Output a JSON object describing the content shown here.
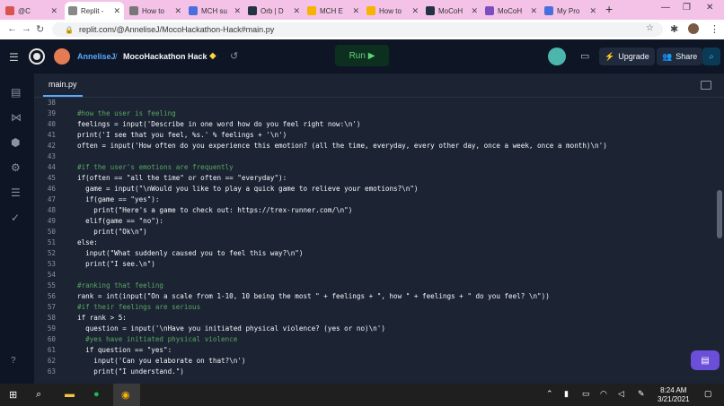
{
  "browser": {
    "tabs": [
      {
        "label": "@C",
        "favicon_color": "#d9534f"
      },
      {
        "label": "Replit -",
        "favicon_color": "#888888",
        "active": true
      },
      {
        "label": "How to",
        "favicon_color": "#777777"
      },
      {
        "label": "MCH su",
        "favicon_color": "#4a6fdc"
      },
      {
        "label": "Orb | D",
        "favicon_color": "#223344"
      },
      {
        "label": "MCH E",
        "favicon_color": "#f4b400"
      },
      {
        "label": "How to",
        "favicon_color": "#f4b400"
      },
      {
        "label": "MoCoH",
        "favicon_color": "#223344"
      },
      {
        "label": "MoCoH",
        "favicon_color": "#7b4fbf"
      },
      {
        "label": "My Pro",
        "favicon_color": "#4a6fdc"
      }
    ],
    "new_tab_icon": "plus-icon",
    "url": "replit.com/@AnneliseJ/MocoHackathon-Hack#main.py"
  },
  "replit": {
    "username": "AnneliseJ",
    "separator": "/",
    "project": "MocoHackathon Hack",
    "run_label": "Run ▶",
    "upgrade_label": "Upgrade",
    "share_label": "Share"
  },
  "editor": {
    "file_tab": "main.py",
    "lines": [
      {
        "n": "38",
        "text": ""
      },
      {
        "n": "39",
        "text": "#how the user is feeling",
        "color": "#58a862"
      },
      {
        "n": "40",
        "text": "feelings = input('Describe in one word how do you feel right now:\\n')"
      },
      {
        "n": "41",
        "text": "print('I see that you feel, %s.' % feelings + '\\n')"
      },
      {
        "n": "42",
        "text": "often = input('How often do you experience this emotion? (all the time, everyday, every other day, once a week, once a month)\\n')"
      },
      {
        "n": "43",
        "text": ""
      },
      {
        "n": "44",
        "text": "#if the user's emotions are frequently",
        "color": "#58a862"
      },
      {
        "n": "45",
        "text": "if(often == \"all the time\" or often == \"everyday\"):"
      },
      {
        "n": "46",
        "text": "  game = input(\"\\nWould you like to play a quick game to relieve your emotions?\\n\")"
      },
      {
        "n": "47",
        "text": "  if(game == \"yes\"):"
      },
      {
        "n": "48",
        "text": "    print(\"Here's a game to check out: https://trex-runner.com/\\n\")"
      },
      {
        "n": "49",
        "text": "  elif(game == \"no\"):"
      },
      {
        "n": "50",
        "text": "    print(\"Ok\\n\")"
      },
      {
        "n": "51",
        "text": "else:"
      },
      {
        "n": "52",
        "text": "  input(\"What suddenly caused you to feel this way?\\n\")"
      },
      {
        "n": "53",
        "text": "  print(\"I see.\\n\")"
      },
      {
        "n": "54",
        "text": ""
      },
      {
        "n": "55",
        "text": "#ranking that feeling",
        "color": "#58a862"
      },
      {
        "n": "56",
        "text": "rank = int(input(\"On a scale from 1-10, 10 being the most \" + feelings + \", how \" + feelings + \" do you feel? \\n\"))"
      },
      {
        "n": "57",
        "text": "#if their feelings are serious",
        "color": "#58a862"
      },
      {
        "n": "58",
        "text": "if rank > 5:"
      },
      {
        "n": "59",
        "text": "  question = input('\\nHave you initiated physical violence? (yes or no)\\n')"
      },
      {
        "n": "60",
        "text": "  #yes have initiated physical violence",
        "color": "#58a862"
      },
      {
        "n": "61",
        "text": "  if question == \"yes\":"
      },
      {
        "n": "62",
        "text": "    input('Can you elaborate on that?\\n')"
      },
      {
        "n": "63",
        "text": "    print(\"I understand.\")"
      }
    ]
  },
  "taskbar": {
    "time": "8:24 AM",
    "date": "3/21/2021"
  }
}
